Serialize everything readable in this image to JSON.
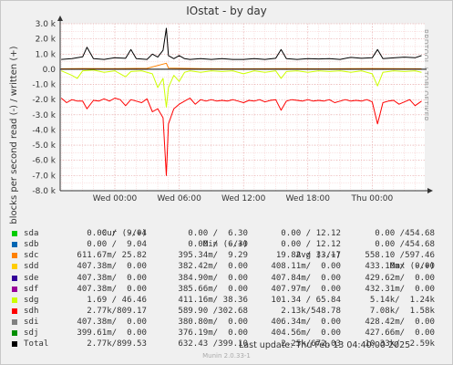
{
  "title": "IOstat - by day",
  "vlabel": "blocks per second read (-) / written (+)",
  "side_text": "RRDTOOL / TOBI OETIKER",
  "legend": {
    "headers": [
      "Cur (-/+)",
      "Min (-/+)",
      "Avg (-/+)",
      "Max (-/+)"
    ],
    "rows": [
      {
        "name": "sda",
        "color": "#00cc00",
        "cur": "0.00 /  9.04",
        "min": "0.00 /  6.30",
        "avg": "0.00 / 12.12",
        "max": "0.00 /454.68"
      },
      {
        "name": "sdb",
        "color": "#0066b3",
        "cur": "0.00 /  9.04",
        "min": "0.00 /  6.30",
        "avg": "0.00 / 12.12",
        "max": "0.00 /454.68"
      },
      {
        "name": "sdc",
        "color": "#ff8000",
        "cur": "611.67m/ 25.82",
        "min": "395.34m/  9.29",
        "avg": "19.82 / 33.17",
        "max": "558.10 /597.46"
      },
      {
        "name": "sdd",
        "color": "#ffcc00",
        "cur": "407.38m/  0.00",
        "min": "382.42m/  0.00",
        "avg": "408.11m/  0.00",
        "max": "433.10m/  0.00"
      },
      {
        "name": "sde",
        "color": "#330099",
        "cur": "407.38m/  0.00",
        "min": "384.90m/  0.00",
        "avg": "407.84m/  0.00",
        "max": "429.62m/  0.00"
      },
      {
        "name": "sdf",
        "color": "#990099",
        "cur": "407.38m/  0.00",
        "min": "385.66m/  0.00",
        "avg": "407.97m/  0.00",
        "max": "432.31m/  0.00"
      },
      {
        "name": "sdg",
        "color": "#ccff00",
        "cur": "1.69 / 46.46",
        "min": "411.16m/ 38.36",
        "avg": "101.34 / 65.84",
        "max": "5.14k/  1.24k"
      },
      {
        "name": "sdh",
        "color": "#ff0000",
        "cur": "2.77k/809.17",
        "min": "589.90 /302.68",
        "avg": "2.13k/548.78",
        "max": "7.08k/  1.58k"
      },
      {
        "name": "sdi",
        "color": "#808080",
        "cur": "407.38m/  0.00",
        "min": "380.80m/  0.00",
        "avg": "406.34m/  0.00",
        "max": "428.42m/  0.00"
      },
      {
        "name": "sdj",
        "color": "#008f00",
        "cur": "399.61m/  0.00",
        "min": "376.19m/  0.00",
        "avg": "404.56m/  0.00",
        "max": "427.66m/  0.00"
      },
      {
        "name": "Total",
        "color": "#000000",
        "cur": "2.77k/899.53",
        "min": "632.43 /399.10",
        "avg": "2.25k/672.03",
        "max": "10.33k/  2.59k"
      }
    ]
  },
  "last_update": "Last update:  Thu Feb 13 04:40:00 2025",
  "footer": "Munin 2.0.33-1",
  "chart_data": {
    "type": "line",
    "title": "IOstat - by day",
    "ylabel": "blocks per second read (-) / written (+)",
    "ylim": [
      -8000,
      3000
    ],
    "yticks": [
      3000,
      2000,
      1000,
      0,
      -1000,
      -2000,
      -3000,
      -4000,
      -5000,
      -6000,
      -7000,
      -8000
    ],
    "ytick_labels": [
      "3.0 k",
      "2.0 k",
      "1.0 k",
      "0.0",
      "-1.0 k",
      "-2.0 k",
      "-3.0 k",
      "-4.0 k",
      "-5.0 k",
      "-6.0 k",
      "-7.0 k",
      "-8.0 k"
    ],
    "xticks": [
      "Wed 00:00",
      "Wed 06:00",
      "Wed 12:00",
      "Wed 18:00",
      "Thu 00:00"
    ],
    "xtick_hours": [
      0,
      6,
      12,
      18,
      24
    ],
    "xlim_hours": [
      -5.1,
      28.9
    ],
    "grid": true,
    "series": [
      {
        "name": "Total",
        "color": "#000000",
        "values": [
          [
            -5.0,
            650
          ],
          [
            -4.0,
            700
          ],
          [
            -3.0,
            820
          ],
          [
            -2.6,
            1450
          ],
          [
            -2.0,
            700
          ],
          [
            -1.0,
            650
          ],
          [
            0.0,
            760
          ],
          [
            1.0,
            720
          ],
          [
            1.5,
            1300
          ],
          [
            2.0,
            700
          ],
          [
            3.0,
            650
          ],
          [
            3.5,
            1000
          ],
          [
            4.0,
            800
          ],
          [
            4.5,
            1250
          ],
          [
            4.8,
            2700
          ],
          [
            5.0,
            900
          ],
          [
            5.5,
            700
          ],
          [
            6.0,
            900
          ],
          [
            6.5,
            700
          ],
          [
            7.0,
            650
          ],
          [
            8.0,
            700
          ],
          [
            9.0,
            650
          ],
          [
            10.0,
            700
          ],
          [
            11.0,
            650
          ],
          [
            12.0,
            650
          ],
          [
            13.0,
            700
          ],
          [
            14.0,
            650
          ],
          [
            15.0,
            720
          ],
          [
            15.5,
            1300
          ],
          [
            16.0,
            700
          ],
          [
            17.0,
            650
          ],
          [
            18.0,
            700
          ],
          [
            19.0,
            680
          ],
          [
            20.0,
            700
          ],
          [
            21.0,
            650
          ],
          [
            22.0,
            780
          ],
          [
            23.0,
            720
          ],
          [
            24.0,
            760
          ],
          [
            24.5,
            1300
          ],
          [
            25.0,
            700
          ],
          [
            26.0,
            750
          ],
          [
            27.0,
            800
          ],
          [
            28.0,
            760
          ],
          [
            28.6,
            900
          ]
        ]
      },
      {
        "name": "sdh",
        "color": "#ff0000",
        "values": [
          [
            -5.0,
            -1900
          ],
          [
            -4.5,
            -2200
          ],
          [
            -4.0,
            -2000
          ],
          [
            -3.5,
            -2100
          ],
          [
            -3.0,
            -2100
          ],
          [
            -2.6,
            -2600
          ],
          [
            -2.0,
            -2050
          ],
          [
            -1.5,
            -2100
          ],
          [
            -1.0,
            -1950
          ],
          [
            -0.5,
            -2100
          ],
          [
            0.0,
            -1900
          ],
          [
            0.5,
            -2000
          ],
          [
            1.0,
            -2400
          ],
          [
            1.5,
            -2000
          ],
          [
            2.0,
            -2100
          ],
          [
            2.5,
            -2200
          ],
          [
            3.0,
            -1950
          ],
          [
            3.5,
            -2800
          ],
          [
            4.0,
            -2600
          ],
          [
            4.5,
            -3200
          ],
          [
            4.8,
            -7000
          ],
          [
            5.0,
            -3600
          ],
          [
            5.5,
            -2600
          ],
          [
            6.0,
            -2300
          ],
          [
            6.5,
            -2100
          ],
          [
            7.0,
            -1900
          ],
          [
            7.5,
            -2300
          ],
          [
            8.0,
            -2000
          ],
          [
            8.5,
            -2100
          ],
          [
            9.0,
            -2000
          ],
          [
            9.5,
            -2100
          ],
          [
            10.0,
            -2050
          ],
          [
            10.5,
            -2100
          ],
          [
            11.0,
            -2000
          ],
          [
            11.5,
            -2100
          ],
          [
            12.0,
            -2200
          ],
          [
            12.5,
            -2050
          ],
          [
            13.0,
            -2100
          ],
          [
            13.5,
            -2000
          ],
          [
            14.0,
            -2150
          ],
          [
            14.5,
            -2050
          ],
          [
            15.0,
            -2000
          ],
          [
            15.5,
            -2700
          ],
          [
            16.0,
            -2100
          ],
          [
            16.5,
            -2000
          ],
          [
            17.0,
            -2050
          ],
          [
            17.5,
            -2100
          ],
          [
            18.0,
            -2000
          ],
          [
            18.5,
            -2100
          ],
          [
            19.0,
            -2050
          ],
          [
            19.5,
            -2100
          ],
          [
            20.0,
            -2000
          ],
          [
            20.5,
            -2200
          ],
          [
            21.0,
            -2100
          ],
          [
            21.5,
            -2000
          ],
          [
            22.0,
            -2100
          ],
          [
            22.5,
            -2050
          ],
          [
            23.0,
            -2100
          ],
          [
            23.5,
            -2000
          ],
          [
            24.0,
            -2150
          ],
          [
            24.5,
            -3600
          ],
          [
            25.0,
            -2200
          ],
          [
            25.5,
            -2100
          ],
          [
            26.0,
            -2050
          ],
          [
            26.5,
            -2300
          ],
          [
            27.0,
            -2150
          ],
          [
            27.5,
            -2000
          ],
          [
            28.0,
            -2400
          ],
          [
            28.6,
            -2100
          ]
        ]
      },
      {
        "name": "sdg",
        "color": "#ccff00",
        "values": [
          [
            -5.0,
            -100
          ],
          [
            -4.0,
            -400
          ],
          [
            -3.5,
            -600
          ],
          [
            -3.0,
            -100
          ],
          [
            -2.0,
            -50
          ],
          [
            -1.0,
            -200
          ],
          [
            0.0,
            -100
          ],
          [
            1.0,
            -500
          ],
          [
            1.5,
            -150
          ],
          [
            2.5,
            -100
          ],
          [
            3.5,
            -300
          ],
          [
            4.0,
            -1200
          ],
          [
            4.5,
            -600
          ],
          [
            4.8,
            -2500
          ],
          [
            5.0,
            -1200
          ],
          [
            5.5,
            -400
          ],
          [
            6.0,
            -800
          ],
          [
            6.5,
            -200
          ],
          [
            7.0,
            -100
          ],
          [
            8.0,
            -200
          ],
          [
            9.0,
            -100
          ],
          [
            10.0,
            -150
          ],
          [
            11.0,
            -100
          ],
          [
            12.0,
            -300
          ],
          [
            13.0,
            -100
          ],
          [
            14.0,
            -200
          ],
          [
            15.0,
            -100
          ],
          [
            15.5,
            -600
          ],
          [
            16.0,
            -150
          ],
          [
            17.0,
            -100
          ],
          [
            18.0,
            -200
          ],
          [
            19.0,
            -100
          ],
          [
            20.0,
            -150
          ],
          [
            21.0,
            -100
          ],
          [
            22.0,
            -200
          ],
          [
            23.0,
            -100
          ],
          [
            24.0,
            -300
          ],
          [
            24.5,
            -1100
          ],
          [
            25.0,
            -200
          ],
          [
            26.0,
            -100
          ],
          [
            27.0,
            -150
          ],
          [
            28.0,
            -100
          ],
          [
            28.6,
            -200
          ]
        ]
      },
      {
        "name": "sdc",
        "color": "#ff8000",
        "values": [
          [
            -5.0,
            30
          ],
          [
            -3.0,
            50
          ],
          [
            0.0,
            40
          ],
          [
            3.0,
            60
          ],
          [
            4.8,
            400
          ],
          [
            5.0,
            80
          ],
          [
            8.0,
            40
          ],
          [
            12.0,
            30
          ],
          [
            16.0,
            40
          ],
          [
            20.0,
            30
          ],
          [
            24.0,
            50
          ],
          [
            28.6,
            30
          ]
        ]
      }
    ]
  }
}
